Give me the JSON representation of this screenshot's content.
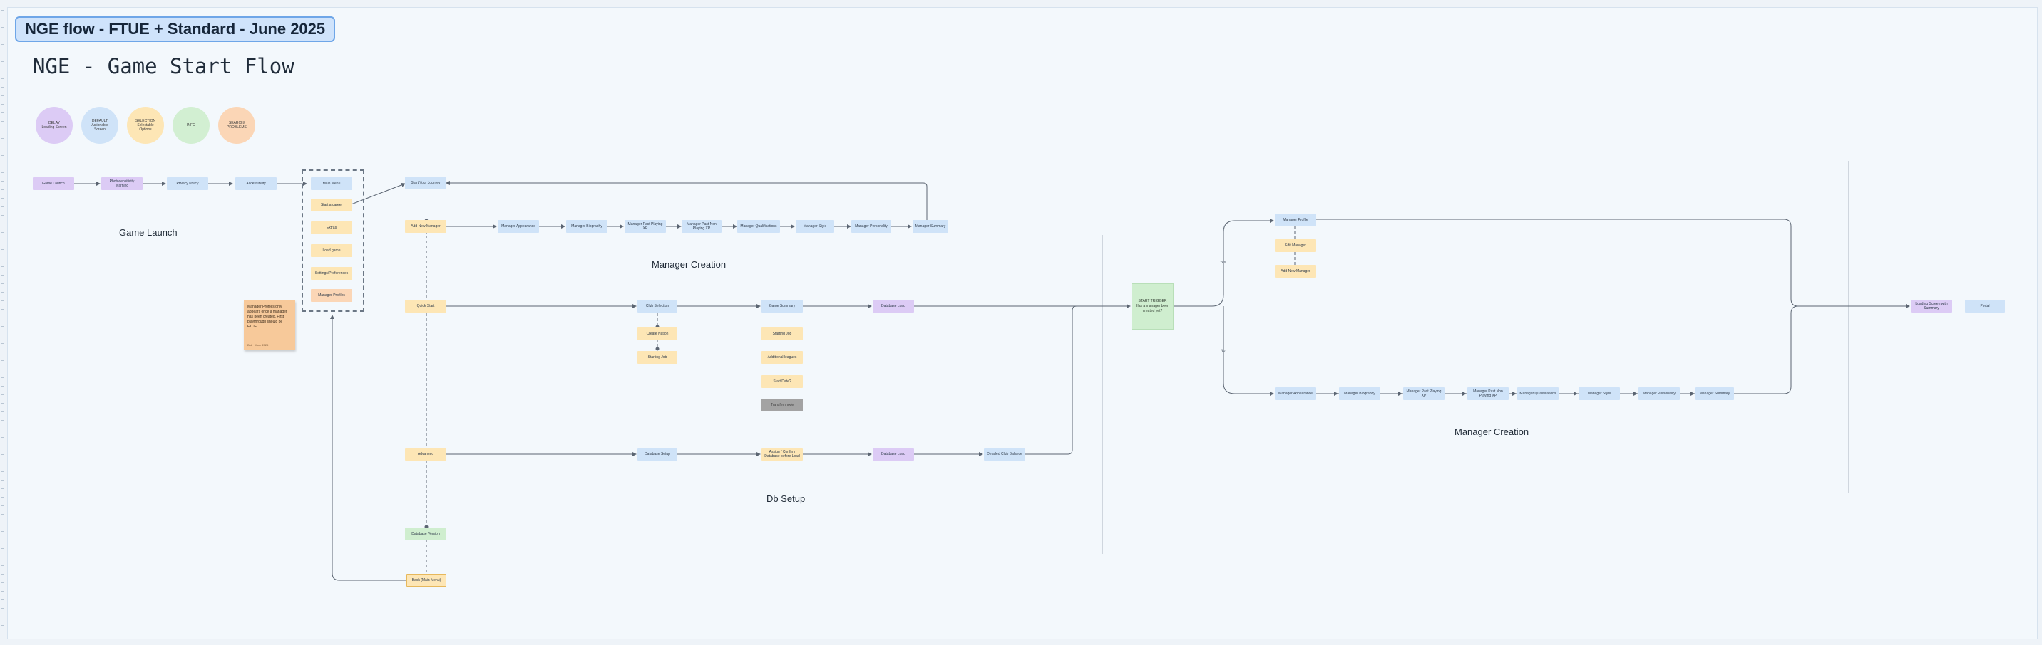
{
  "board_title": "NGE flow - FTUE + Standard - June 2025",
  "flow_title": "NGE - Game Start Flow",
  "legend": [
    {
      "l1": "DELAY",
      "l2": "Loading Screen",
      "color": "#dccbf5"
    },
    {
      "l1": "DEFAULT",
      "l2": "Actionable",
      "l3": "Screen",
      "color": "#cfe3f8"
    },
    {
      "l1": "SELECTION",
      "l2": "Selectable",
      "l3": "Options",
      "color": "#fde6b5"
    },
    {
      "l1": "INFO",
      "color": "#d2efd2"
    },
    {
      "l1": "SEARCH/",
      "l2": "PROBLEMS",
      "color": "#fbd6b6"
    }
  ],
  "sections": {
    "game_launch": "Game Launch",
    "manager_creation_1": "Manager Creation",
    "db_setup": "Db Setup",
    "manager_creation_2": "Manager Creation"
  },
  "launch": {
    "game_launch": "Game Launch",
    "photosensitivity_warning": "Photosensitivity Warning",
    "privacy_policy": "Privacy Policy",
    "accessibility": "Accessibility"
  },
  "menu": {
    "main_menu": "Main Menu",
    "start_a_career": "Start a career",
    "extras": "Extras",
    "load_game": "Load game",
    "settings_preferences": "Settings/Preferences",
    "manager_profiles": "Manager Profiles"
  },
  "note": {
    "text": "Manager Profiles only appears once a manager has been created. First playthrough should be FTUE.",
    "author": "Bob · June 2025"
  },
  "mgr_row": [
    "Manager Appearance",
    "Manager Biography",
    "Manager Past Playing XP",
    "Manager Past Non Playing XP",
    "Manager Qualifications",
    "Manager Style",
    "Manager Personality",
    "Manager Summary"
  ],
  "nodes": {
    "start_your_journey": "Start Your Journey",
    "add_new_manager": "Add New Manager",
    "quick_start": "Quick Start",
    "advanced": "Advanced",
    "database_version": "Database Version",
    "back_main_menu": "Back (Main Menu)",
    "club_selection": "Club Selection",
    "create_nation": "Create Nation",
    "starting_job": "Starting Job",
    "game_summary": "Game Summary",
    "starting_job_opt": "Starting Job",
    "additional_leagues": "Additional leagues",
    "start_date": "Start Date?",
    "transfer_mode": "Transfer mode",
    "database_load_1": "Database Load",
    "database_setup": "Database Setup",
    "assign_confirm": "Assign / Confirm Database before Load",
    "database_load_2": "Database Load",
    "detailed_club_balance": "Detailed Club Balance",
    "manager_profile": "Manager Profile",
    "edit_manager": "Edit Manager",
    "add_new_manager_2": "Add New Manager",
    "loading_screen": "Loading Screen with Summary",
    "portal": "Portal"
  },
  "start_trigger": {
    "l1": "START TRIGGER",
    "l2": "Has a manager been",
    "l3": "created yet?"
  },
  "edge_labels": {
    "yes": "Yes",
    "no": "No"
  }
}
